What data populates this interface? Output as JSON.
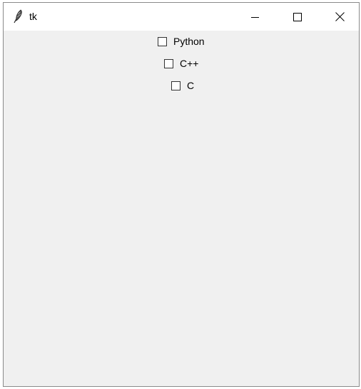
{
  "window": {
    "title": "tk",
    "icon": "feather-icon",
    "controls": {
      "minimize_icon": "minimize-icon",
      "maximize_icon": "maximize-icon",
      "close_icon": "close-icon"
    }
  },
  "checkboxes": [
    {
      "label": "Python",
      "checked": false
    },
    {
      "label": "C++",
      "checked": false
    },
    {
      "label": "C",
      "checked": false
    }
  ],
  "colors": {
    "titlebar": "#ffffff",
    "client_bg": "#f0f0f0",
    "border": "#8a8a8a"
  }
}
